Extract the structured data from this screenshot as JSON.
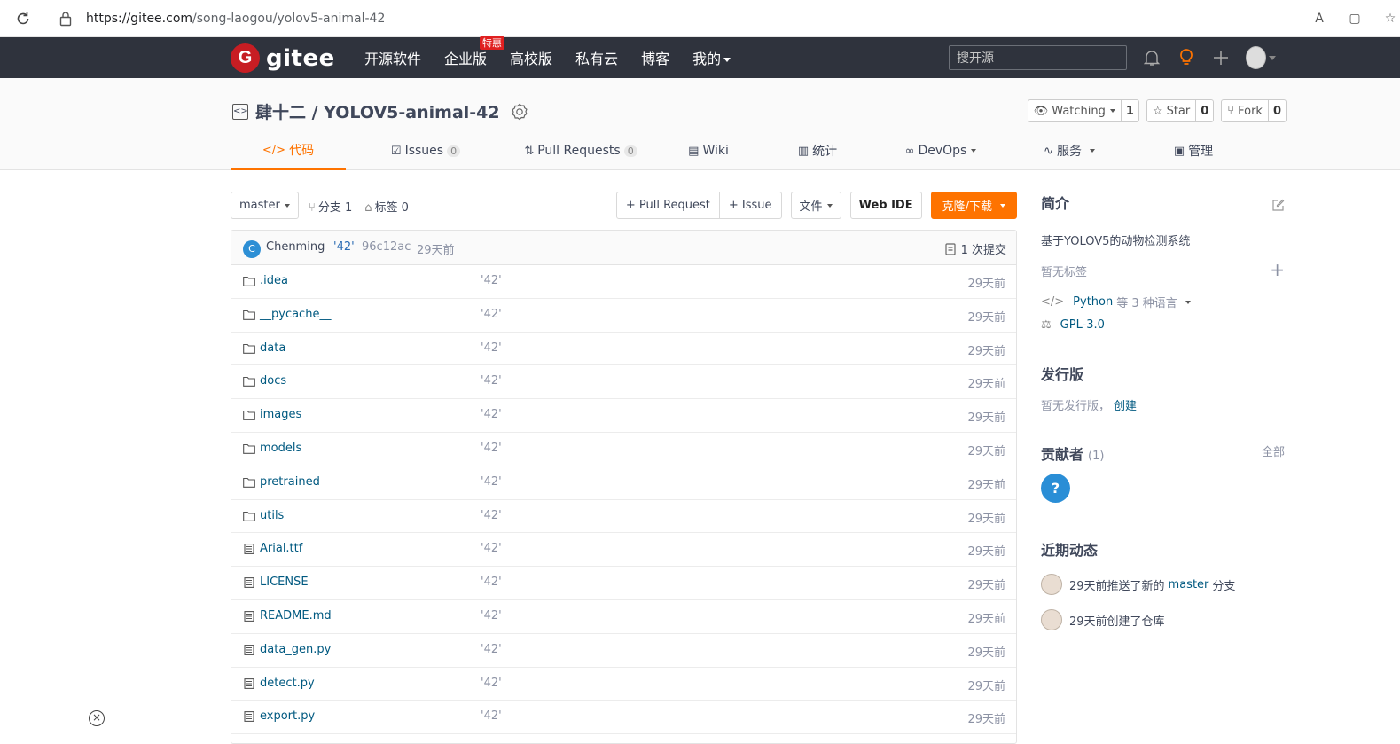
{
  "browser": {
    "url_host": "https://gitee.com",
    "url_path": "/song-laogou/yolov5-animal-42"
  },
  "header": {
    "logo_mark": "G",
    "logo_text": "gitee",
    "nav": [
      {
        "label": "开源软件"
      },
      {
        "label": "企业版",
        "badge": "特惠"
      },
      {
        "label": "高校版"
      },
      {
        "label": "私有云"
      },
      {
        "label": "博客"
      },
      {
        "label": "我的"
      }
    ],
    "search_placeholder": "搜开源",
    "accent": "#fe7300"
  },
  "repo": {
    "owner": "肆十二",
    "name": "YOLOV5-animal-42",
    "title": "肆十二 / YOLOV5-animal-42",
    "watching_label": "Watching",
    "watching_count": "1",
    "star_label": "Star",
    "star_count": "0",
    "fork_label": "Fork",
    "fork_count": "0"
  },
  "tabs": [
    {
      "icon": "code-icon",
      "label": "代码",
      "active": true
    },
    {
      "icon": "issues-icon",
      "label": "Issues",
      "count": "0"
    },
    {
      "icon": "pr-icon",
      "label": "Pull Requests",
      "count": "0"
    },
    {
      "icon": "wiki-icon",
      "label": "Wiki"
    },
    {
      "icon": "stats-icon",
      "label": "统计"
    },
    {
      "icon": "devops-icon",
      "label": "DevOps"
    },
    {
      "icon": "service-icon",
      "label": "服务"
    },
    {
      "icon": "manage-icon",
      "label": "管理"
    }
  ],
  "toolbar": {
    "branch": "master",
    "branches": "分支 1",
    "tags": "标签 0",
    "pull_request": "+ Pull Request",
    "issue": "+ Issue",
    "file": "文件",
    "web_ide": "Web IDE",
    "clone": "克隆/下载"
  },
  "commit": {
    "avatar_letter": "C",
    "author": "Chenming",
    "message": "'42'",
    "sha": "96c12ac",
    "time": "29天前",
    "count_label": "1 次提交"
  },
  "files": [
    {
      "type": "folder",
      "name": ".idea",
      "message": "'42'",
      "time": "29天前"
    },
    {
      "type": "folder",
      "name": "__pycache__",
      "message": "'42'",
      "time": "29天前"
    },
    {
      "type": "folder",
      "name": "data",
      "message": "'42'",
      "time": "29天前"
    },
    {
      "type": "folder",
      "name": "docs",
      "message": "'42'",
      "time": "29天前"
    },
    {
      "type": "folder",
      "name": "images",
      "message": "'42'",
      "time": "29天前"
    },
    {
      "type": "folder",
      "name": "models",
      "message": "'42'",
      "time": "29天前"
    },
    {
      "type": "folder",
      "name": "pretrained",
      "message": "'42'",
      "time": "29天前"
    },
    {
      "type": "folder",
      "name": "utils",
      "message": "'42'",
      "time": "29天前"
    },
    {
      "type": "file",
      "name": "Arial.ttf",
      "message": "'42'",
      "time": "29天前"
    },
    {
      "type": "file",
      "name": "LICENSE",
      "message": "'42'",
      "time": "29天前"
    },
    {
      "type": "file",
      "name": "README.md",
      "message": "'42'",
      "time": "29天前"
    },
    {
      "type": "file",
      "name": "data_gen.py",
      "message": "'42'",
      "time": "29天前"
    },
    {
      "type": "file",
      "name": "detect.py",
      "message": "'42'",
      "time": "29天前"
    },
    {
      "type": "file",
      "name": "export.py",
      "message": "'42'",
      "time": "29天前"
    }
  ],
  "sidebar": {
    "intro_title": "简介",
    "description": "基于YOLOV5的动物检测系统",
    "no_tags": "暂无标签",
    "language": "Python",
    "language_more": "等 3 种语言",
    "license": "GPL-3.0",
    "releases_title": "发行版",
    "no_releases": "暂无发行版，",
    "create": "创建",
    "contributors_title": "贡献者",
    "contributors_count": "(1)",
    "all": "全部",
    "contributor_avatar": "?",
    "activity_title": "近期动态",
    "activity": [
      {
        "text": "29天前推送了新的",
        "branch": "master",
        "suffix": "分支"
      },
      {
        "text": "29天前创建了仓库"
      }
    ]
  }
}
